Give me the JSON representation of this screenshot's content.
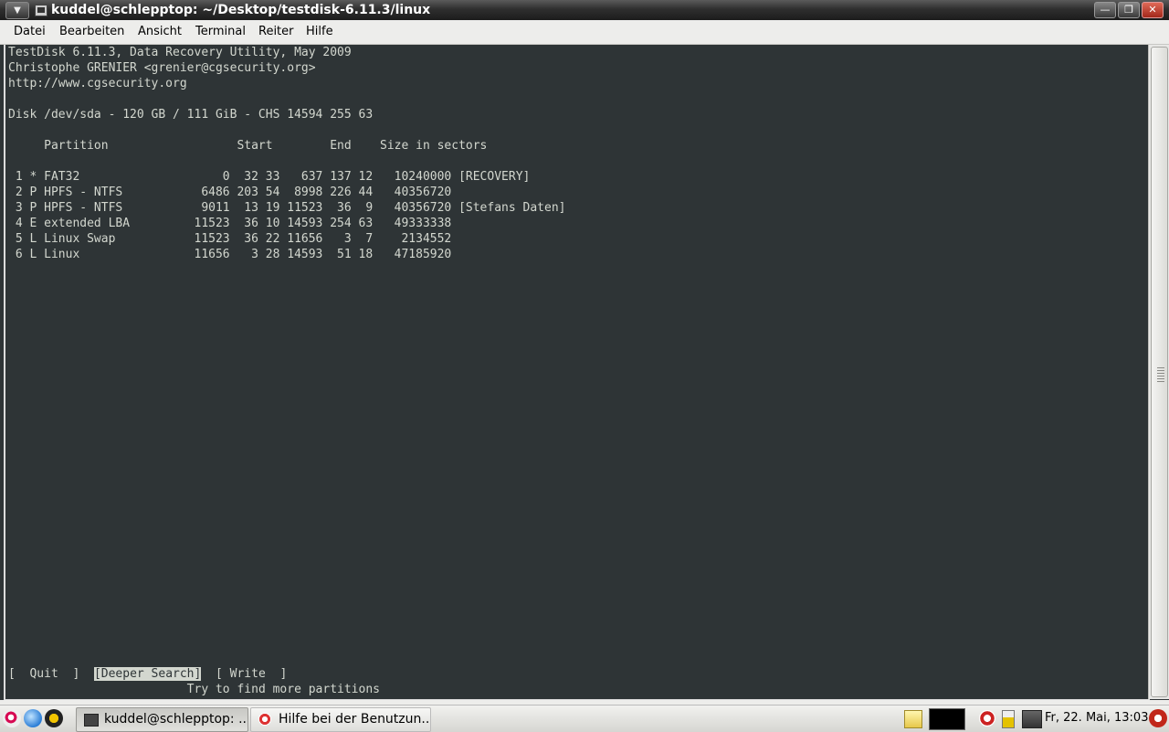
{
  "window": {
    "title": "kuddel@schlepptop: ~/Desktop/testdisk-6.11.3/linux",
    "buttons": {
      "minimize": "—",
      "maximize": "❐",
      "close": "✕"
    }
  },
  "menubar": [
    "Datei",
    "Bearbeiten",
    "Ansicht",
    "Terminal",
    "Reiter",
    "Hilfe"
  ],
  "terminal": {
    "header": [
      "TestDisk 6.11.3, Data Recovery Utility, May 2009",
      "Christophe GRENIER <grenier@cgsecurity.org>",
      "http://www.cgsecurity.org"
    ],
    "disk_line": "Disk /dev/sda - 120 GB / 111 GiB - CHS 14594 255 63",
    "table_header": "     Partition                  Start        End    Size in sectors",
    "partitions": [
      " 1 * FAT32                    0  32 33   637 137 12   10240000 [RECOVERY]",
      " 2 P HPFS - NTFS           6486 203 54  8998 226 44   40356720",
      " 3 P HPFS - NTFS           9011  13 19 11523  36  9   40356720 [Stefans Daten]",
      " 4 E extended LBA         11523  36 10 14593 254 63   49333338",
      " 5 L Linux Swap           11523  36 22 11656   3  7    2134552",
      " 6 L Linux                11656   3 28 14593  51 18   47185920"
    ],
    "actions": {
      "quit": "[  Quit  ]",
      "deeper_search": "[Deeper Search]",
      "write": "[ Write  ]"
    },
    "hint": "Try to find more partitions"
  },
  "taskbar": {
    "tasks": [
      {
        "label": "kuddel@schlepptop: ...",
        "active": true
      },
      {
        "label": "Hilfe bei der Benutzun...",
        "active": false
      }
    ],
    "clock": "Fr, 22. Mai, 13:03"
  },
  "icons": {
    "window_menu": "chevron-down-icon",
    "terminal_app": "terminal-icon",
    "launchers": [
      "debian-swirl-icon",
      "browser-icon",
      "system-monitor-icon"
    ],
    "tray": [
      "notes-icon",
      "terminal-monitor-icon",
      "lifebuoy-icon",
      "battery-icon",
      "network-icon",
      "power-icon"
    ]
  },
  "colors": {
    "terminal_bg": "#2e3436",
    "terminal_fg": "#d3d7cf",
    "titlebar_bg": "#2f2f2f",
    "menubar_bg": "#ededeb"
  }
}
